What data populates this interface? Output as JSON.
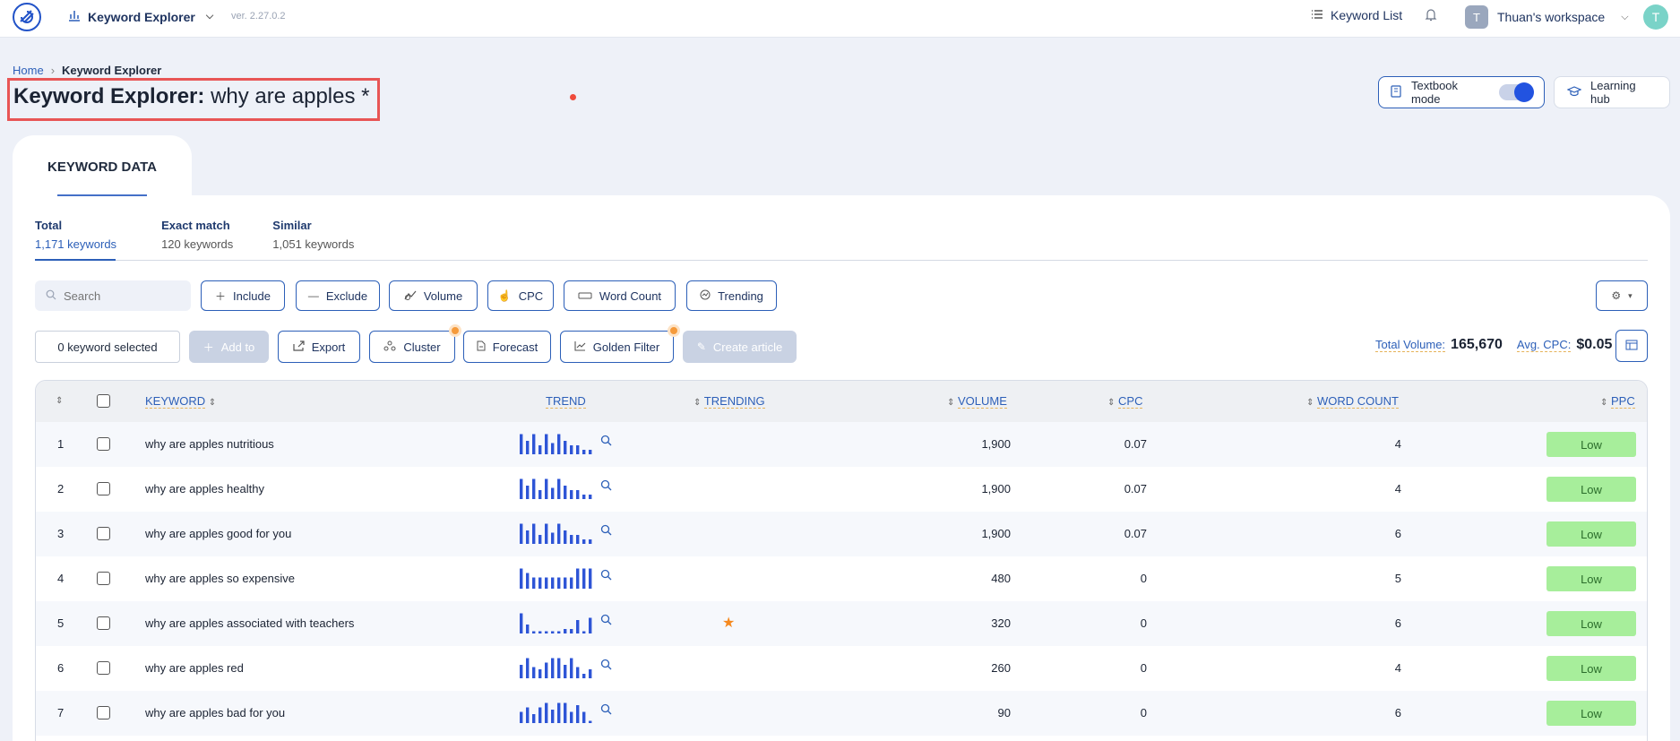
{
  "topbar": {
    "app_name": "Keyword Explorer",
    "version": "ver. 2.27.0.2",
    "keyword_list": "Keyword List",
    "workspace_initial": "T",
    "workspace_name": "Thuan's workspace",
    "user_initial": "T"
  },
  "breadcrumb": {
    "home": "Home",
    "sep": "›",
    "current": "Keyword Explorer"
  },
  "title": {
    "prefix": "Keyword Explorer:",
    "query": "why are apples *"
  },
  "header_actions": {
    "textbook_mode": "Textbook mode",
    "textbook_on": true,
    "learning_hub": "Learning hub"
  },
  "panel_tab": "KEYWORD DATA",
  "subtabs": [
    {
      "label": "Total",
      "count": "1,171 keywords"
    },
    {
      "label": "Exact match",
      "count": "120 keywords"
    },
    {
      "label": "Similar",
      "count": "1,051 keywords"
    }
  ],
  "filters": {
    "search_placeholder": "Search",
    "include": "Include",
    "exclude": "Exclude",
    "volume": "Volume",
    "cpc": "CPC",
    "word_count": "Word Count",
    "trending": "Trending"
  },
  "actions": {
    "selected": "0 keyword selected",
    "add_to": "Add to",
    "export": "Export",
    "cluster": "Cluster",
    "forecast": "Forecast",
    "golden_filter": "Golden Filter",
    "create_article": "Create article"
  },
  "totals": {
    "volume_label": "Total Volume:",
    "volume": "165,670",
    "cpc_label": "Avg. CPC:",
    "cpc": "$0.05"
  },
  "table": {
    "headers": {
      "keyword": "KEYWORD",
      "trend": "TREND",
      "trending": "TRENDING",
      "volume": "VOLUME",
      "cpc": "CPC",
      "word_count": "WORD COUNT",
      "ppc": "PPC"
    },
    "rows": [
      {
        "num": "1",
        "keyword": "why are apples nutritious",
        "volume": "1,900",
        "cpc": "0.07",
        "words": "4",
        "ppc": "Low",
        "trending": false,
        "trend": [
          9,
          6,
          9,
          4,
          9,
          5,
          9,
          6,
          4,
          4,
          2,
          2
        ]
      },
      {
        "num": "2",
        "keyword": "why are apples healthy",
        "volume": "1,900",
        "cpc": "0.07",
        "words": "4",
        "ppc": "Low",
        "trending": false,
        "trend": [
          9,
          6,
          9,
          4,
          9,
          5,
          9,
          6,
          4,
          4,
          2,
          2
        ]
      },
      {
        "num": "3",
        "keyword": "why are apples good for you",
        "volume": "1,900",
        "cpc": "0.07",
        "words": "6",
        "ppc": "Low",
        "trending": false,
        "trend": [
          9,
          6,
          9,
          4,
          9,
          5,
          9,
          6,
          4,
          4,
          2,
          2
        ]
      },
      {
        "num": "4",
        "keyword": "why are apples so expensive",
        "volume": "480",
        "cpc": "0",
        "words": "5",
        "ppc": "Low",
        "trending": false,
        "trend": [
          9,
          7,
          5,
          5,
          5,
          5,
          5,
          5,
          5,
          9,
          9,
          9
        ]
      },
      {
        "num": "5",
        "keyword": "why are apples associated with teachers",
        "volume": "320",
        "cpc": "0",
        "words": "6",
        "ppc": "Low",
        "trending": true,
        "trend": [
          9,
          4,
          1,
          1,
          1,
          1,
          1,
          2,
          2,
          6,
          1,
          7
        ]
      },
      {
        "num": "6",
        "keyword": "why are apples red",
        "volume": "260",
        "cpc": "0",
        "words": "4",
        "ppc": "Low",
        "trending": false,
        "trend": [
          6,
          9,
          5,
          4,
          7,
          9,
          9,
          6,
          9,
          5,
          2,
          4
        ]
      },
      {
        "num": "7",
        "keyword": "why are apples bad for you",
        "volume": "90",
        "cpc": "0",
        "words": "6",
        "ppc": "Low",
        "trending": false,
        "trend": [
          5,
          7,
          4,
          7,
          9,
          6,
          9,
          9,
          5,
          8,
          5,
          1
        ]
      }
    ]
  },
  "colors": {
    "accent": "#2c5fb8",
    "trend_bar": "#2e55d6",
    "ppc_low": "#a7ee9b",
    "highlight": "#e85555",
    "star": "#f5891f"
  }
}
